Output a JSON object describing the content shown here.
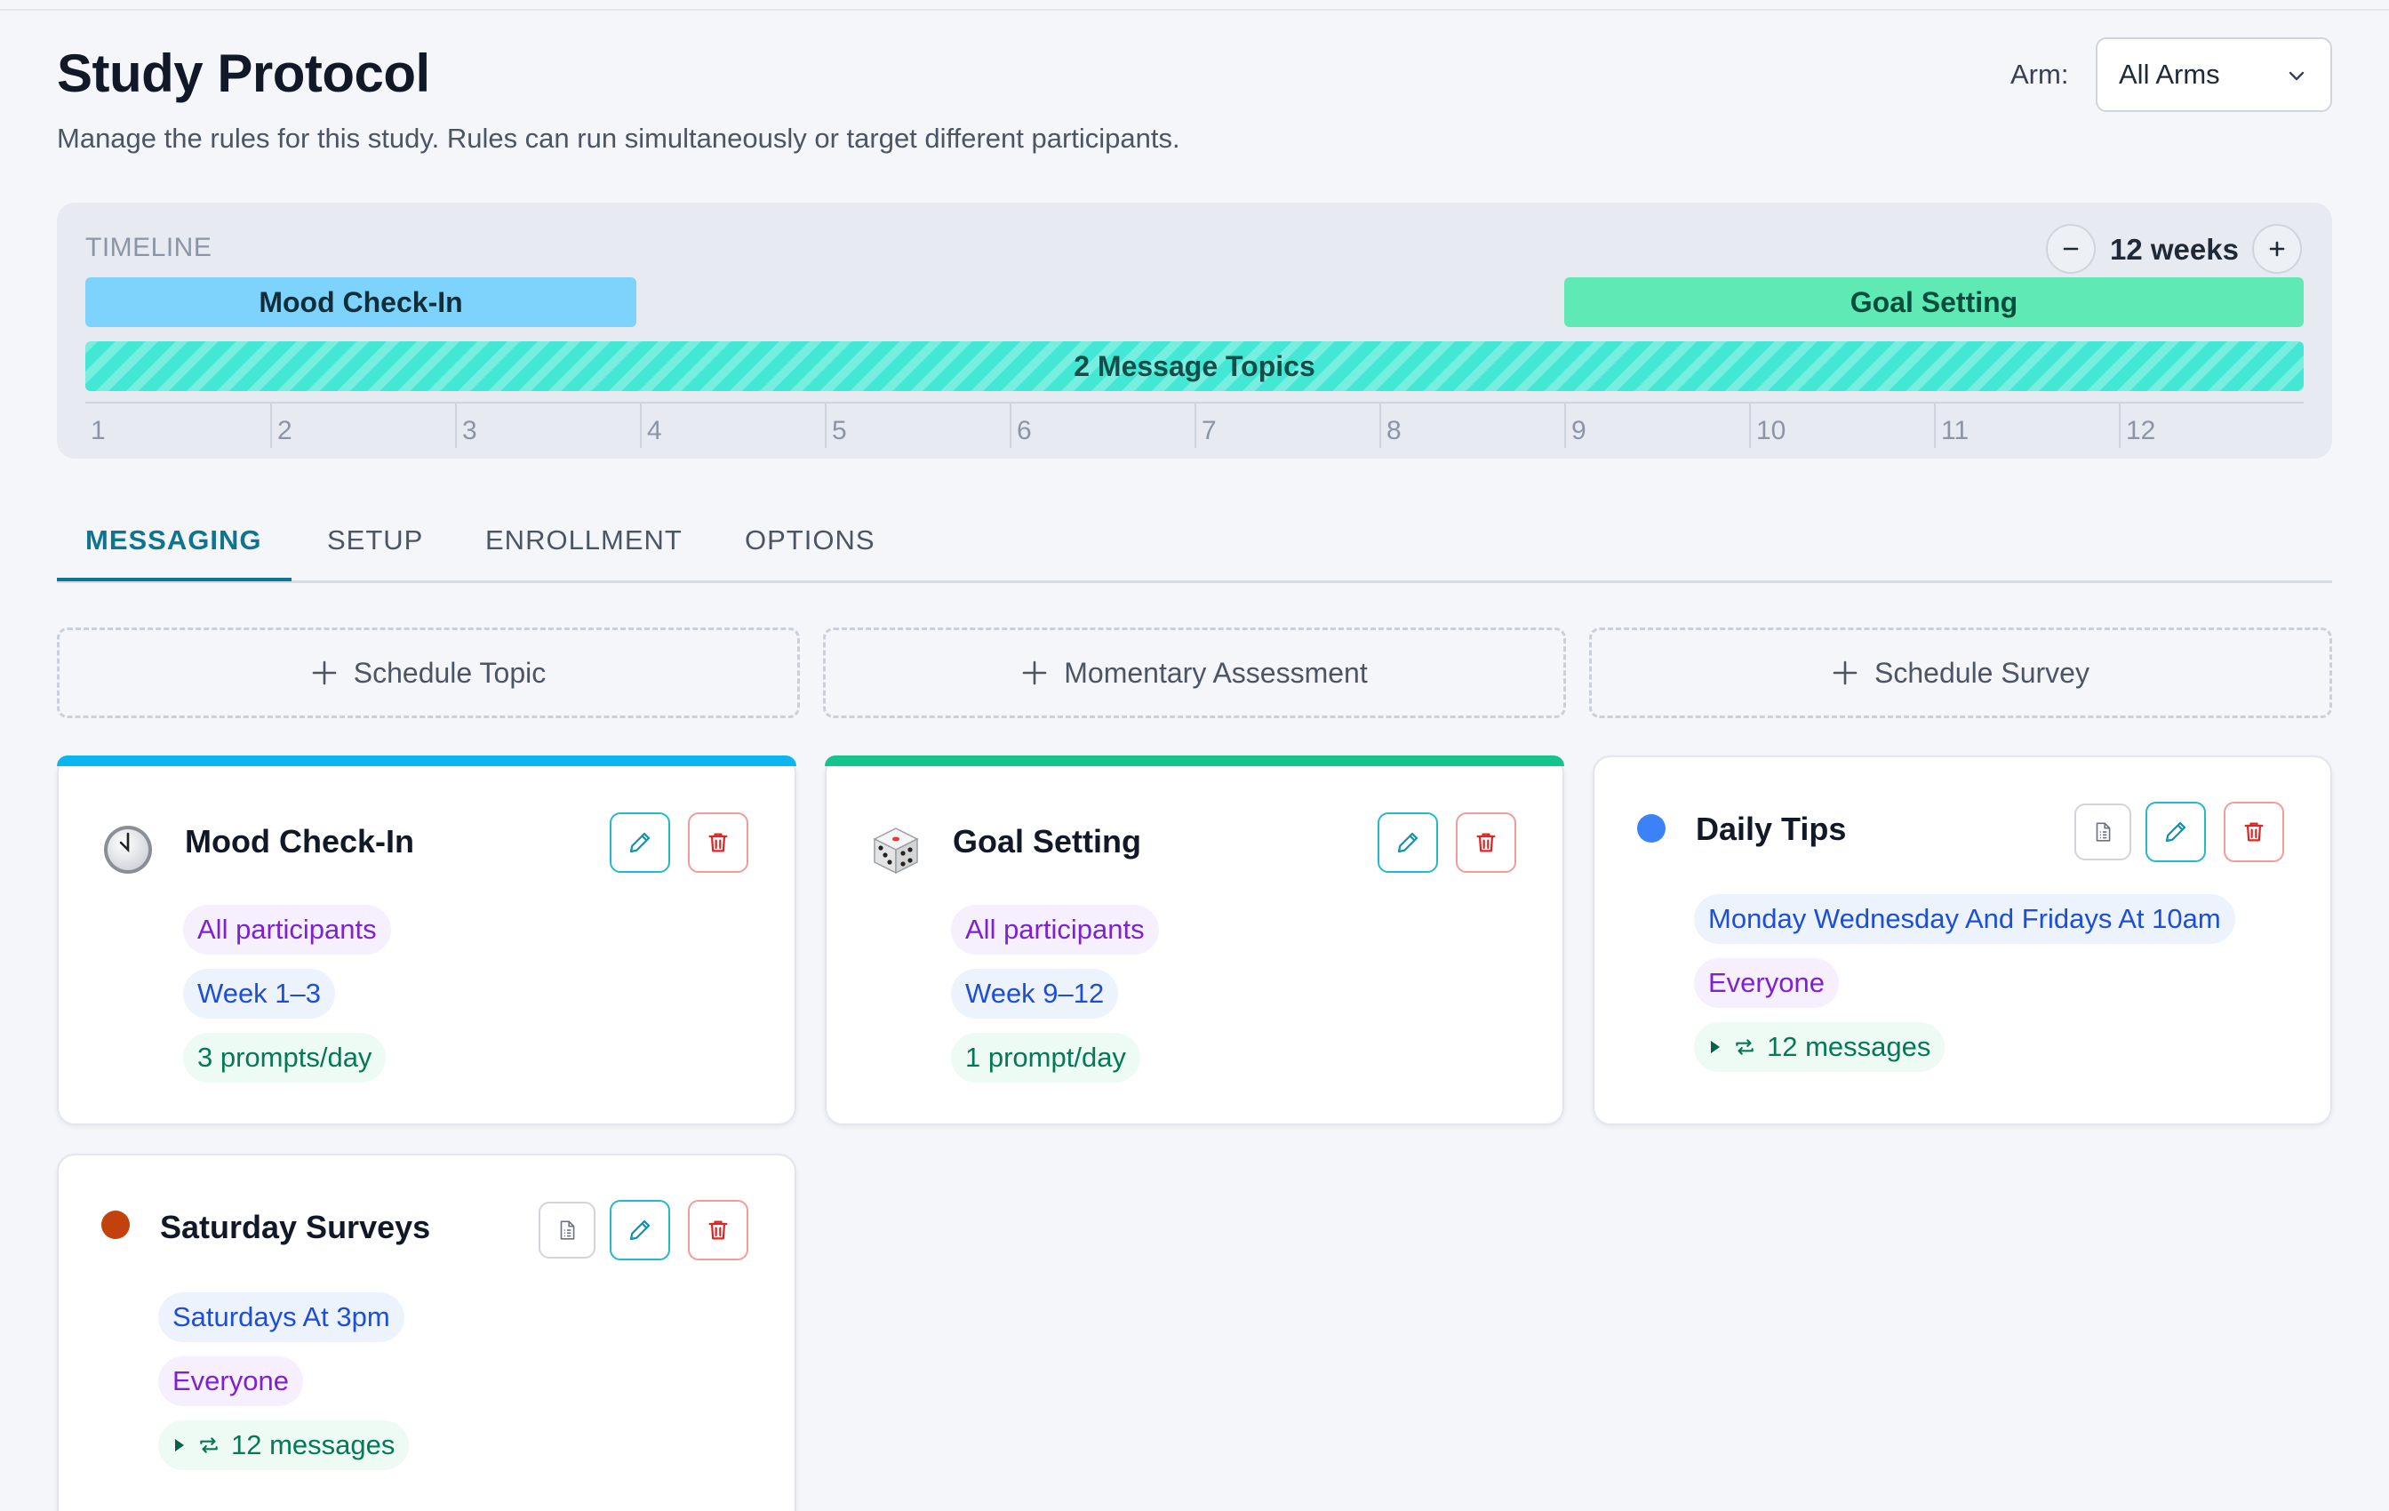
{
  "header": {
    "title": "Study Protocol",
    "subtitle": "Manage the rules for this study. Rules can run simultaneously or target different participants.",
    "arm_label": "Arm:",
    "arm_selected": "All Arms"
  },
  "timeline": {
    "label": "TIMELINE",
    "zoom_value": "12 weeks",
    "bars": {
      "mood": "Mood Check-In",
      "goal": "Goal Setting",
      "topics": "2 Message Topics"
    },
    "ticks": [
      "1",
      "2",
      "3",
      "4",
      "5",
      "6",
      "7",
      "8",
      "9",
      "10",
      "11",
      "12"
    ]
  },
  "tabs": [
    "MESSAGING",
    "SETUP",
    "ENROLLMENT",
    "OPTIONS"
  ],
  "add_buttons": {
    "topic": "Schedule Topic",
    "assessment": "Momentary Assessment",
    "survey": "Schedule Survey"
  },
  "cards": {
    "mood": {
      "title": "Mood Check-In",
      "audience": "All participants",
      "weeks": "Week 1–3",
      "frequency": "3 prompts/day",
      "accent": "#0ab6f0"
    },
    "goal": {
      "title": "Goal Setting",
      "audience": "All participants",
      "weeks": "Week 9–12",
      "frequency": "1 prompt/day",
      "accent": "#13c58a"
    },
    "tips": {
      "title": "Daily Tips",
      "schedule": "Monday Wednesday And Fridays At 10am",
      "audience": "Everyone",
      "messages": "12 messages",
      "dot_color": "#3b82f6"
    },
    "surveys": {
      "title": "Saturday Surveys",
      "schedule": "Saturdays At 3pm",
      "audience": "Everyone",
      "messages": "12 messages",
      "dot_color": "#c2410c"
    }
  }
}
